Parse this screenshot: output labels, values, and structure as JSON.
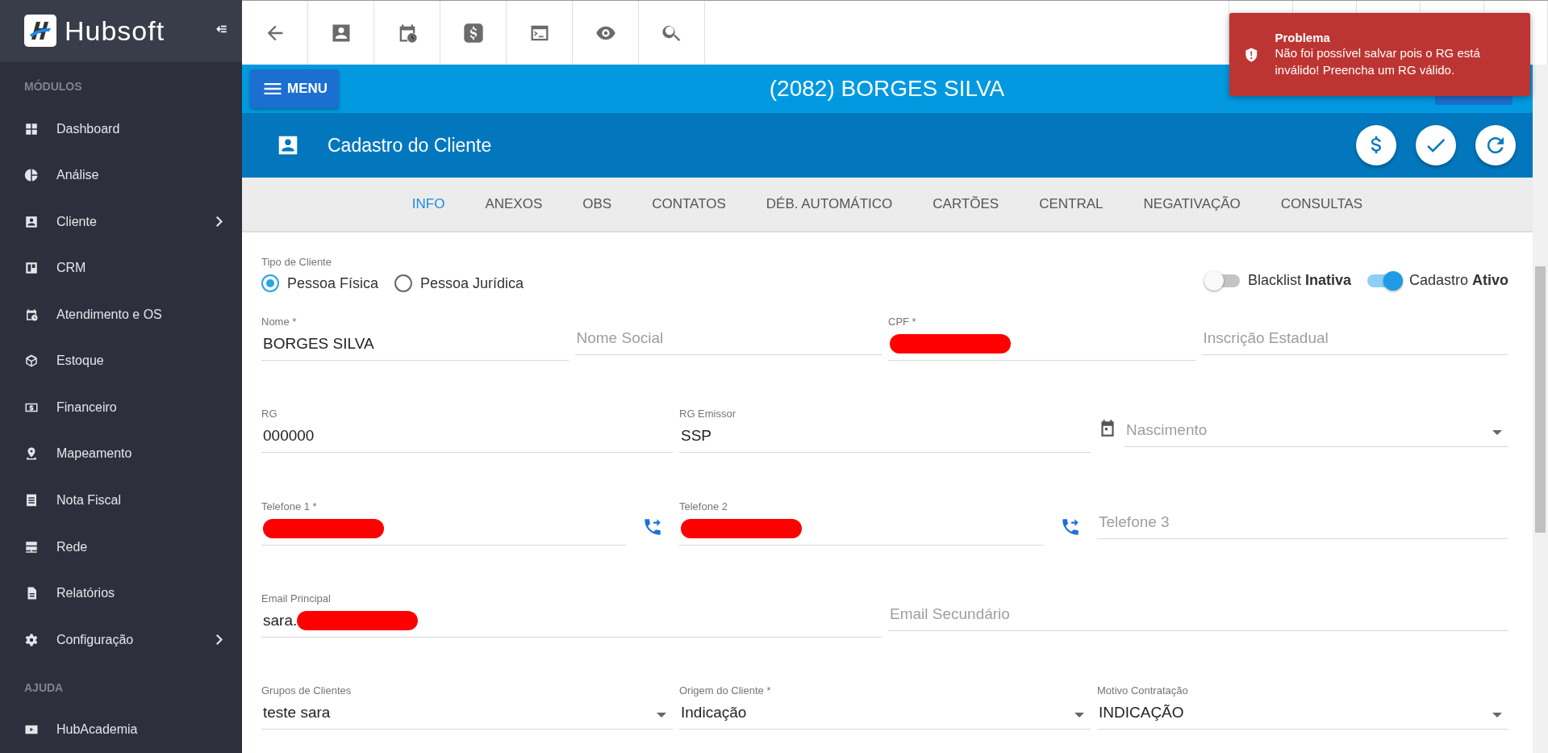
{
  "sidebar": {
    "brand": "Hubsoft",
    "sections": [
      {
        "title": "MÓDULOS",
        "items": [
          {
            "label": "Dashboard",
            "has_submenu": false
          },
          {
            "label": "Análise",
            "has_submenu": false
          },
          {
            "label": "Cliente",
            "has_submenu": true
          },
          {
            "label": "CRM",
            "has_submenu": false
          },
          {
            "label": "Atendimento e OS",
            "has_submenu": false
          },
          {
            "label": "Estoque",
            "has_submenu": false
          },
          {
            "label": "Financeiro",
            "has_submenu": false
          },
          {
            "label": "Mapeamento",
            "has_submenu": false
          },
          {
            "label": "Nota Fiscal",
            "has_submenu": false
          },
          {
            "label": "Rede",
            "has_submenu": false
          },
          {
            "label": "Relatórios",
            "has_submenu": false
          },
          {
            "label": "Configuração",
            "has_submenu": true
          }
        ]
      },
      {
        "title": "AJUDA",
        "items": [
          {
            "label": "HubAcademia",
            "has_submenu": false
          }
        ]
      }
    ]
  },
  "header": {
    "menu_button": "MENU",
    "title": "(2082) BORGES SILVA"
  },
  "page": {
    "title": "Cadastro do Cliente"
  },
  "tabs": [
    {
      "label": "INFO",
      "selected": true
    },
    {
      "label": "ANEXOS",
      "selected": false
    },
    {
      "label": "OBS",
      "selected": false
    },
    {
      "label": "CONTATOS",
      "selected": false
    },
    {
      "label": "DÉB. AUTOMÁTICO",
      "selected": false
    },
    {
      "label": "CARTÕES",
      "selected": false
    },
    {
      "label": "CENTRAL",
      "selected": false
    },
    {
      "label": "NEGATIVAÇÃO",
      "selected": false
    },
    {
      "label": "CONSULTAS",
      "selected": false
    }
  ],
  "client_type": {
    "label": "Tipo de Cliente",
    "options": [
      {
        "label": "Pessoa Física",
        "selected": true
      },
      {
        "label": "Pessoa Jurídica",
        "selected": false
      }
    ]
  },
  "switches": [
    {
      "label": "Blacklist **Inativa**",
      "on": false
    },
    {
      "label": "Cadastro **Ativo**",
      "on": true
    }
  ],
  "rows": [
    [
      {
        "kind": "text",
        "label": "Nome *",
        "value": "BORGES SILVA",
        "redacted": false
      },
      {
        "kind": "text",
        "placeholder": "Nome Social",
        "redacted": false
      },
      {
        "kind": "text",
        "label": "CPF *",
        "redacted": true
      },
      {
        "kind": "text",
        "placeholder": "Inscrição Estadual",
        "redacted": false
      }
    ],
    [
      {
        "kind": "text",
        "label": "RG",
        "value": "000000",
        "redacted": false
      },
      {
        "kind": "text",
        "label": "RG Emissor",
        "value": "SSP",
        "redacted": false
      },
      {
        "kind": "date",
        "placeholder": "Nascimento",
        "redacted": false
      }
    ],
    [
      {
        "kind": "phone",
        "label": "Telefone 1 *",
        "redacted": true
      },
      {
        "kind": "phone",
        "label": "Telefone 2",
        "redacted": true
      },
      {
        "kind": "text",
        "placeholder": "Telefone 3",
        "redacted": false
      }
    ],
    [
      {
        "kind": "text",
        "label": "Email Principal",
        "value": "sara.",
        "redacted": true
      },
      {
        "kind": "text",
        "placeholder": "Email Secundário",
        "redacted": false
      }
    ],
    [
      {
        "kind": "select",
        "label": "Grupos de Clientes",
        "value": "teste sara",
        "redacted": false
      },
      {
        "kind": "select",
        "label": "Origem do Cliente *",
        "value": "Indicação",
        "redacted": false
      },
      {
        "kind": "select",
        "label": "Motivo Contratação",
        "value": "INDICAÇÃO",
        "redacted": false
      }
    ]
  ],
  "toast": {
    "title": "Problema",
    "message": "Não foi possível salvar pois o RG está inválido! Preencha um RG válido."
  }
}
